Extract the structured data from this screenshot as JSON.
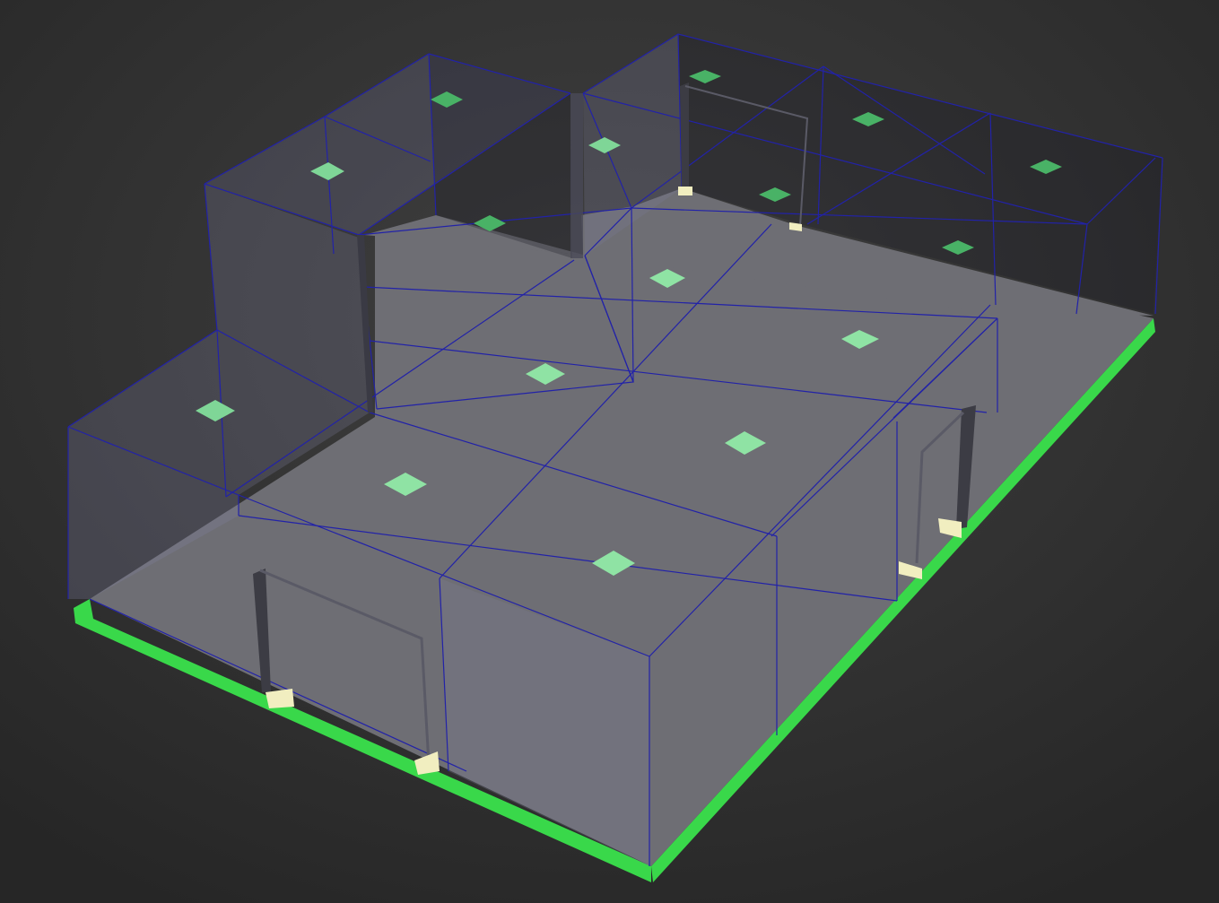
{
  "viewport": {
    "background_top": "#404040",
    "background_bottom": "#262626"
  },
  "scene": {
    "floor_color": "#6e6e74",
    "floor_edge_color": "#39d84a",
    "wall_tint": "#8a8aa6",
    "wire_color": "#2222a8",
    "light_panel_color": "#8fe3a4",
    "light_panel_dark_color": "#49b266",
    "door_frame_color": "#3c3c44",
    "door_hinge_color": "#f1eec0"
  }
}
